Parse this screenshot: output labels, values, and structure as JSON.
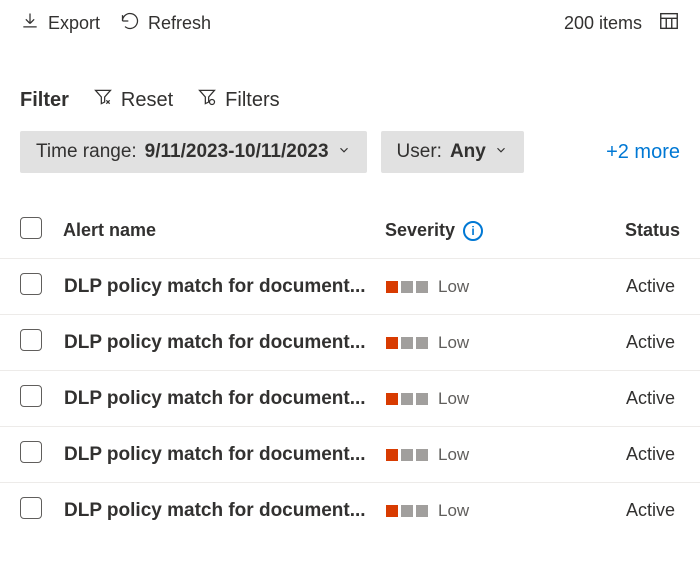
{
  "toolbar": {
    "export_label": "Export",
    "refresh_label": "Refresh",
    "item_count": "200 items"
  },
  "filterbar": {
    "filter_label": "Filter",
    "reset_label": "Reset",
    "filters_label": "Filters"
  },
  "pills": {
    "time_range_label": "Time range:",
    "time_range_value": "9/11/2023-10/11/2023",
    "user_label": "User:",
    "user_value": "Any",
    "more_label": "+2 more"
  },
  "columns": {
    "alert_name": "Alert name",
    "severity": "Severity",
    "status": "Status"
  },
  "severity_levels": {
    "low": "Low"
  },
  "status_values": {
    "active": "Active"
  },
  "rows": [
    {
      "name": "DLP policy match for document...",
      "severity": "Low",
      "severity_level": 1,
      "status": "Active"
    },
    {
      "name": "DLP policy match for document...",
      "severity": "Low",
      "severity_level": 1,
      "status": "Active"
    },
    {
      "name": "DLP policy match for document...",
      "severity": "Low",
      "severity_level": 1,
      "status": "Active"
    },
    {
      "name": "DLP policy match for document...",
      "severity": "Low",
      "severity_level": 1,
      "status": "Active"
    },
    {
      "name": "DLP policy match for document...",
      "severity": "Low",
      "severity_level": 1,
      "status": "Active"
    }
  ]
}
